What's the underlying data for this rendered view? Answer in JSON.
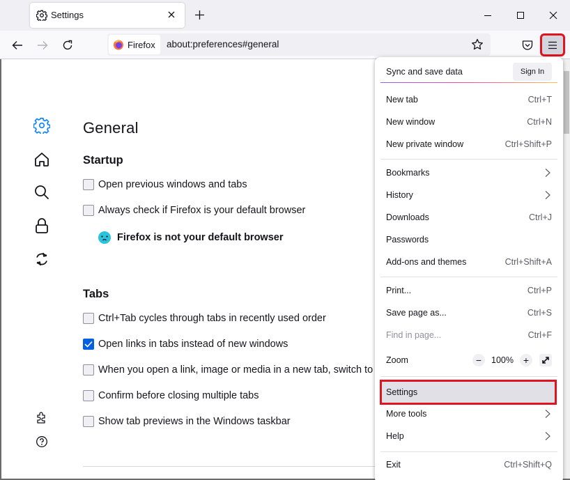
{
  "window": {
    "tab_title": "Settings",
    "tab_icon": "gear-icon",
    "new_tab_icon": "plus-icon",
    "controls": [
      "minimize-icon",
      "maximize-icon",
      "close-icon"
    ]
  },
  "navbar": {
    "identity_label": "Firefox",
    "url": "about:preferences#general",
    "icons": [
      "back-arrow-icon",
      "forward-arrow-icon",
      "reload-icon",
      "bookmark-star-icon",
      "pocket-icon",
      "hamburger-menu-icon"
    ]
  },
  "sidebar": {
    "items": [
      {
        "name": "general",
        "icon": "gear-icon",
        "active": true
      },
      {
        "name": "home",
        "icon": "home-icon"
      },
      {
        "name": "search",
        "icon": "search-icon"
      },
      {
        "name": "privacy",
        "icon": "lock-icon"
      },
      {
        "name": "sync",
        "icon": "sync-icon"
      }
    ],
    "footer": [
      {
        "name": "extensions",
        "icon": "puzzle-icon"
      },
      {
        "name": "support",
        "icon": "help-icon"
      }
    ]
  },
  "content": {
    "title": "General",
    "startup": {
      "heading": "Startup",
      "options": [
        {
          "label": "Open previous windows and tabs",
          "checked": false
        },
        {
          "label": "Always check if Firefox is your default browser",
          "checked": false
        }
      ],
      "default_status": "Firefox is not your default browser"
    },
    "tabs": {
      "heading": "Tabs",
      "options": [
        {
          "label": "Ctrl+Tab cycles through tabs in recently used order",
          "checked": false
        },
        {
          "label": "Open links in tabs instead of new windows",
          "checked": true
        },
        {
          "label": "When you open a link, image or media in a new tab, switch to it immediately",
          "checked": false
        },
        {
          "label": "Confirm before closing multiple tabs",
          "checked": false
        },
        {
          "label": "Show tab previews in the Windows taskbar",
          "checked": false
        }
      ]
    }
  },
  "menu": {
    "sync_label": "Sync and save data",
    "sign_in": "Sign In",
    "items": [
      {
        "label": "New tab",
        "shortcut": "Ctrl+T"
      },
      {
        "label": "New window",
        "shortcut": "Ctrl+N"
      },
      {
        "label": "New private window",
        "shortcut": "Ctrl+Shift+P"
      },
      {
        "label": "Bookmarks",
        "submenu": true
      },
      {
        "label": "History",
        "submenu": true
      },
      {
        "label": "Downloads",
        "shortcut": "Ctrl+J"
      },
      {
        "label": "Passwords"
      },
      {
        "label": "Add-ons and themes",
        "shortcut": "Ctrl+Shift+A"
      },
      {
        "label": "Print...",
        "shortcut": "Ctrl+P"
      },
      {
        "label": "Save page as...",
        "shortcut": "Ctrl+S"
      },
      {
        "label": "Find in page...",
        "shortcut": "Ctrl+F",
        "disabled": true
      },
      {
        "label": "Zoom",
        "zoom_value": "100%",
        "zoom_out": "−",
        "zoom_in": "+"
      },
      {
        "label": "Settings",
        "highlighted": true
      },
      {
        "label": "More tools",
        "submenu": true
      },
      {
        "label": "Help",
        "submenu": true
      },
      {
        "label": "Exit",
        "shortcut": "Ctrl+Shift+Q"
      }
    ]
  },
  "colors": {
    "accent": "#0061e0",
    "sidebar_active": "#0a84ff",
    "highlight_outline": "#e0141e",
    "menu_highlight": "#e0e0e6"
  }
}
